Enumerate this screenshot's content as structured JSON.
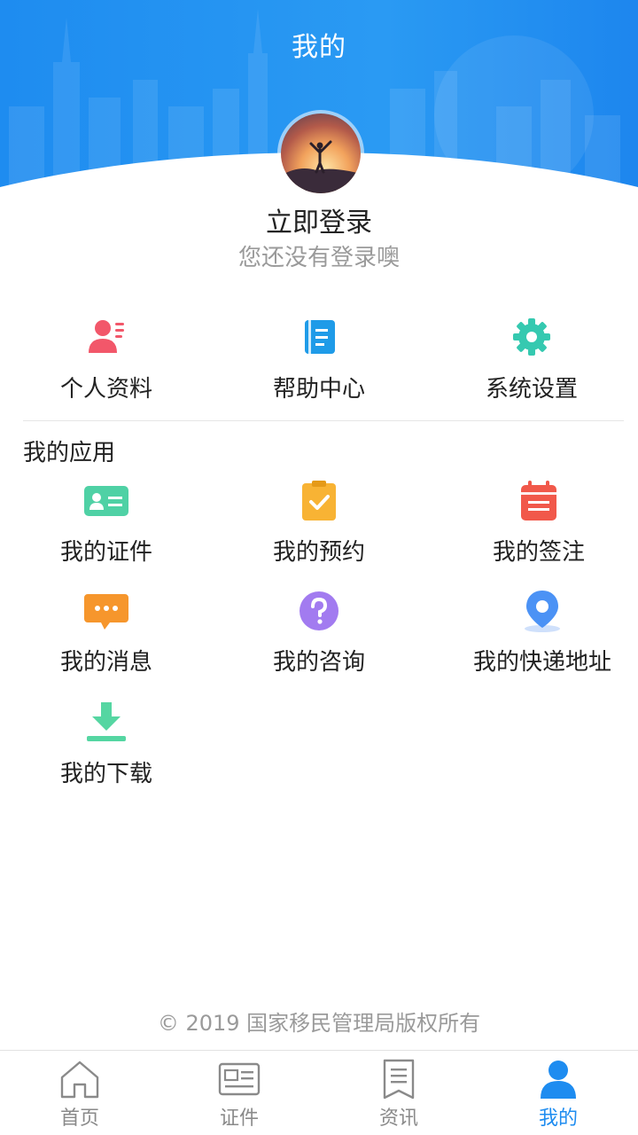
{
  "header": {
    "title": "我的"
  },
  "profile": {
    "login_title": "立即登录",
    "login_subtitle": "您还没有登录噢"
  },
  "quick_actions": [
    {
      "label": "个人资料",
      "icon": "user-card-icon",
      "color": "#f2576a"
    },
    {
      "label": "帮助中心",
      "icon": "book-icon",
      "color": "#1f9be8"
    },
    {
      "label": "系统设置",
      "icon": "gear-icon",
      "color": "#35c9b0"
    }
  ],
  "section": {
    "title": "我的应用"
  },
  "apps": [
    {
      "label": "我的证件",
      "icon": "id-card-icon",
      "color": "#4fd1a5"
    },
    {
      "label": "我的预约",
      "icon": "clipboard-check-icon",
      "color": "#f8b334"
    },
    {
      "label": "我的签注",
      "icon": "calendar-icon",
      "color": "#f1584a"
    },
    {
      "label": "我的消息",
      "icon": "message-icon",
      "color": "#f6962c"
    },
    {
      "label": "我的咨询",
      "icon": "question-icon",
      "color": "#a27bf0"
    },
    {
      "label": "我的快递地址",
      "icon": "location-pin-icon",
      "color": "#4b92f5"
    },
    {
      "label": "我的下载",
      "icon": "download-icon",
      "color": "#55d6a2"
    }
  ],
  "footer": {
    "copyright": "© 2019 国家移民管理局版权所有"
  },
  "tabbar": {
    "items": [
      {
        "label": "首页",
        "icon": "home-icon"
      },
      {
        "label": "证件",
        "icon": "id-card-outline-icon"
      },
      {
        "label": "资讯",
        "icon": "news-icon"
      },
      {
        "label": "我的",
        "icon": "person-icon"
      }
    ],
    "active_index": 3,
    "active_color": "#1e8cf0",
    "inactive_color": "#8a8a8a"
  }
}
